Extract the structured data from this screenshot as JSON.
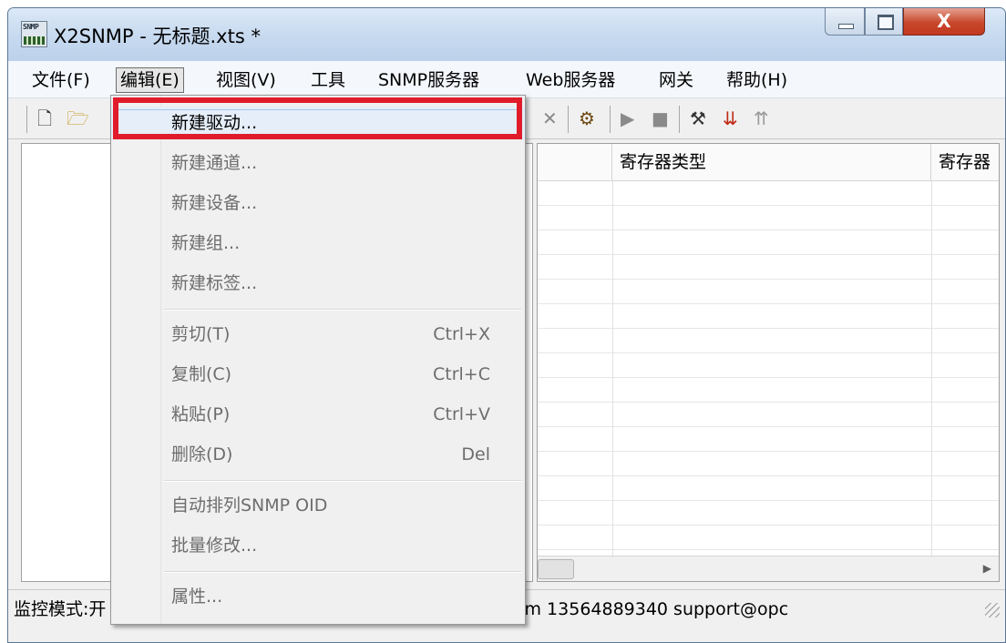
{
  "window": {
    "title": "X2SNMP - 无标题.xts *",
    "app_icon_text": "SNMP"
  },
  "title_buttons": {
    "close_glyph": "X"
  },
  "menubar": [
    {
      "label": "文件(F)"
    },
    {
      "label": "编辑(E)",
      "active": true
    },
    {
      "label": "视图(V)"
    },
    {
      "label": "工具"
    },
    {
      "label": "SNMP服务器"
    },
    {
      "label": "Web服务器"
    },
    {
      "label": "网关"
    },
    {
      "label": "帮助(H)"
    }
  ],
  "toolbar": {
    "icons": [
      "new-file-icon",
      "open-folder-icon",
      "delete-icon",
      "wizard-icon",
      "play-icon",
      "stop-icon",
      "tools-icon",
      "load-icon",
      "upload-icon"
    ]
  },
  "grid": {
    "columns": [
      "寄存器类型",
      "寄存器"
    ]
  },
  "status": {
    "text": "监控模式:开 | 创建点数:0 | 支持点数:1024 | www.opcmaster.com 13564889340 support@opc"
  },
  "edit_menu": {
    "items": [
      {
        "label": "新建驱动...",
        "shortcut": "",
        "enabled": true,
        "highlighted": true
      },
      {
        "label": "新建通道...",
        "shortcut": "",
        "enabled": false
      },
      {
        "label": "新建设备...",
        "shortcut": "",
        "enabled": false
      },
      {
        "label": "新建组...",
        "shortcut": "",
        "enabled": false
      },
      {
        "label": "新建标签...",
        "shortcut": "",
        "enabled": false
      },
      {
        "label": "剪切(T)",
        "shortcut": "Ctrl+X",
        "enabled": false
      },
      {
        "label": "复制(C)",
        "shortcut": "Ctrl+C",
        "enabled": false
      },
      {
        "label": "粘贴(P)",
        "shortcut": "Ctrl+V",
        "enabled": false
      },
      {
        "label": "删除(D)",
        "shortcut": "Del",
        "enabled": false
      },
      {
        "label": "自动排列SNMP OID",
        "shortcut": "",
        "enabled": false
      },
      {
        "label": "批量修改...",
        "shortcut": "",
        "enabled": false
      },
      {
        "label": "属性...",
        "shortcut": "",
        "enabled": false
      }
    ]
  }
}
